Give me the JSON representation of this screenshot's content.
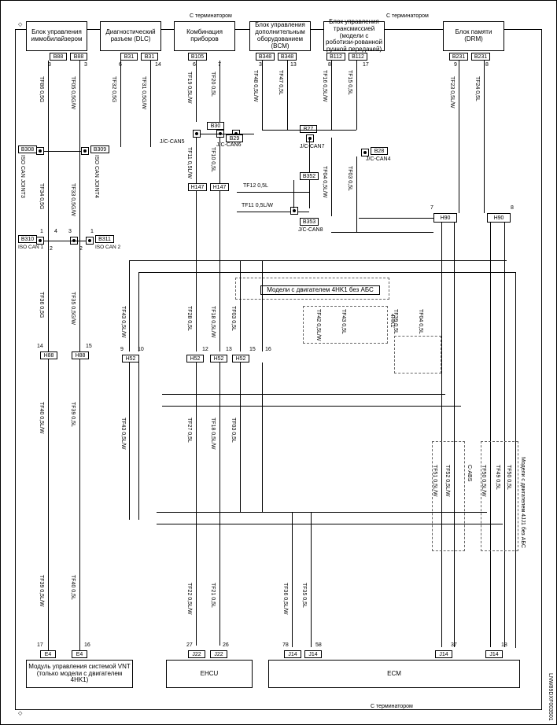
{
  "header_note_left": "С терминатором",
  "header_note_right": "С терминатором",
  "footer_note": "С терминатором",
  "top_modules": {
    "immobilizer": "Блок управления иммобилайзером",
    "diag": "Диагностический разъем (DLC)",
    "instrument": "Комбинация приборов",
    "bcm": "Блок управления дополнительным оборудованием (BCM)",
    "trans": "Блок управления трансмиссией (модели с роботизи-рованной ручной передачей)",
    "drm": "Блок памяти (DRM)"
  },
  "bottom_modules": {
    "vnt": "Модуль управления системой VNT (только модели с двигателем 4HK1)",
    "ehcu": "EHCU",
    "ecm": "ECM"
  },
  "jc": {
    "can5": "J/C-CAN5",
    "can6": "J/C-CAN6",
    "can7": "J/C-CAN7",
    "can4": "J/C-CAN4",
    "can8": "J/C-CAN8",
    "iso1": "ISO CAN 1",
    "iso2": "ISO CAN 2",
    "isoj3": "ISO CAN JOINT3",
    "isoj4": "ISO CAN JOINT4"
  },
  "dashed_notes": {
    "mid": "Модели с двигателем 4HK1 без АБС",
    "right": "Модели с двигателем 4JJ1 без АБС",
    "small1": "4HK1",
    "small2": "C-ABS"
  },
  "conns": {
    "B88a": "B88",
    "B88b": "B88",
    "B31a": "B31",
    "B31b": "B31",
    "B105": "B105",
    "B348a": "B348",
    "B348b": "B348",
    "B112a": "B112",
    "B112b": "B112",
    "B231a": "B231",
    "B231b": "B231",
    "B30": "B30",
    "B29": "B29",
    "B27": "B27",
    "B28": "B28",
    "B352": "B352",
    "B353": "B353",
    "H147a": "H147",
    "H147b": "H147",
    "H90a": "H90",
    "H90b": "H90",
    "B308": "B308",
    "B309": "B309",
    "B310": "B310",
    "B311": "B311",
    "H88a": "H88",
    "H88b": "H88",
    "H52a": "H52",
    "H52b": "H52",
    "H52c": "H52",
    "H52d": "H52",
    "E4a": "E4",
    "E4b": "E4",
    "J22a": "J22",
    "J22b": "J22",
    "J14a": "J14",
    "J14b": "J14",
    "J14c": "J14",
    "J14d": "J14"
  },
  "wires": {
    "TF86": "TF86 0,5G",
    "TF05": "TF05 0,5G/W",
    "TF32": "TF32 0,5G",
    "TF31": "TF31 0,5G/W",
    "TF19": "TF19 0,5L/W",
    "TF20": "TF20 0,5L",
    "TF48": "TF48 0,5L/W",
    "TF47": "TF47 0,5L",
    "TF16": "TF16 0,5L/W",
    "TF15": "TF15 0,5L",
    "TF23": "TF23 0,5L/W",
    "TF24": "TF24 0,5L",
    "TF34": "TF34 0,5G",
    "TF33": "TF33 0,5G/W",
    "TF11": "TF11 0,5L/W",
    "TF10": "TF10 0,5L",
    "TF11b": "TF11 0,5L/W",
    "TF12b": "TF12 0,5L",
    "TF04": "TF04 0,5L/W",
    "TF03": "TF03 0,5L",
    "TF36": "TF36 0,5G",
    "TF35": "TF35 0,5G/W",
    "TF43": "TF43 0,5L/W",
    "TF28": "TF28 0,5L",
    "TF18": "TF18 0,5L/W",
    "TF03b": "TF03 0,5L",
    "TF42": "TF42 0,5L/W",
    "TF43b": "TF43 0,5L",
    "TF39": "TF39 0,5L/W",
    "TF04b": "TF04 0,5L",
    "TF43c": "TF43 0,5L/W",
    "TF27": "TF27 0,5L",
    "TF18b": "TF18 0,5L/W",
    "TF03c": "TF03 0,5L",
    "TF51": "TF51 0,5L/W",
    "TF40": "TF40 0,5L",
    "TF50": "TF50 0,5L/W",
    "TF49": "TF49 0,5L",
    "TF52": "TF52 0,5L/W",
    "TF39c": "TF39 0,5L",
    "TF49b": "TF49 0,5L/W",
    "TF50b": "TF50 0,5L",
    "TF40b": "TF40 0,5L/W",
    "TF39b": "TF39 0,5L",
    "TF22": "TF22 0,5L/W",
    "TF21": "TF21 0,5L",
    "TF36b": "TF36 0,5L/W",
    "TF35b": "TF35 0,5L"
  },
  "pins": {
    "p1": "1",
    "p2": "2",
    "p3": "3",
    "p4": "4",
    "p5": "5",
    "p6": "6",
    "p7": "7",
    "p8": "8",
    "p9": "9",
    "p10": "10",
    "p12": "12",
    "p13": "13",
    "p14": "14",
    "p15": "15",
    "p16": "16",
    "p17": "17",
    "p18": "18",
    "p26": "26",
    "p27": "27",
    "p37": "37",
    "p58": "58",
    "p78": "78"
  },
  "doc_id": "LNW89DXF003501"
}
